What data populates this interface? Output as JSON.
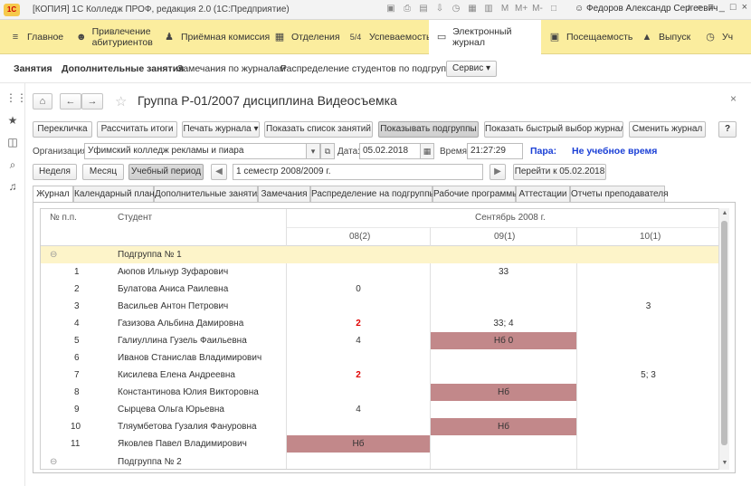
{
  "window": {
    "caption": "[КОПИЯ] 1С Колледж ПРОФ, редакция 2.0  (1С:Предприятие)",
    "user": "Федоров Александр Сергеевич"
  },
  "sections": [
    {
      "label": "Главное",
      "icon": "list-icon"
    },
    {
      "label": "Привлечение абитуриентов",
      "icon": "person-icon"
    },
    {
      "label": "Приёмная комиссия",
      "icon": "walk-icon"
    },
    {
      "label": "Отделения",
      "icon": "building-icon"
    },
    {
      "label": "Успеваемость",
      "icon": "grade-icon",
      "icon_text": "5/4"
    },
    {
      "label": "Электронный журнал",
      "icon": "book-icon"
    },
    {
      "label": "Посещаемость",
      "icon": "calendar-icon"
    },
    {
      "label": "Выпуск",
      "icon": "cap-icon"
    },
    {
      "label": "Уч",
      "icon": "clock-icon"
    }
  ],
  "funcbar": {
    "items": [
      "Занятия",
      "Дополнительные занятия",
      "Замечания по журналам",
      "Распределение студентов по подгруппам"
    ],
    "service": "Сервис"
  },
  "doc": {
    "title": "Группа Р-01/2007 дисциплина Видеосъемка"
  },
  "toolbar": {
    "b1": "Перекличка",
    "b2": "Рассчитать итоги",
    "b3": "Печать журнала",
    "b4": "Показать список занятий",
    "b5": "Показывать подгруппы",
    "b6": "Показать быстрый выбор журнала",
    "b7": "Сменить журнал",
    "help": "?"
  },
  "filters": {
    "org_label": "Организация:",
    "org_value": "Уфимский колледж рекламы и пиара",
    "date_label": "Дата:",
    "date_value": "05.02.2018",
    "time_label": "Время:",
    "time_value": "21:27:29",
    "para_label": "Пара:",
    "para_value": "Не учебное время"
  },
  "period": {
    "week": "Неделя",
    "month": "Месяц",
    "study": "Учебный период",
    "value": "1 семестр 2008/2009 г.",
    "goto": "Перейти к 05.02.2018"
  },
  "tabs": [
    "Журнал",
    "Календарный план",
    "Дополнительные занятия",
    "Замечания",
    "Распределение на подгруппы",
    "Рабочие программы",
    "Аттестации",
    "Отчеты преподавателя"
  ],
  "grid": {
    "col_num": "№ п.п.",
    "col_student": "Студент",
    "month": "Сентябрь 2008 г.",
    "days": [
      "08(2)",
      "09(1)",
      "10(1)"
    ],
    "groups": [
      "Подгруппа № 1",
      "Подгруппа № 2"
    ],
    "rows": [
      {
        "n": "1",
        "name": "Аюпов Ильнур Зуфарович",
        "d1": "",
        "d2": "33",
        "d3": ""
      },
      {
        "n": "2",
        "name": "Булатова Аниса Раилевна",
        "d1": "0",
        "d2": "",
        "d3": ""
      },
      {
        "n": "3",
        "name": "Васильев Антон Петрович",
        "d1": "",
        "d2": "",
        "d3": "3"
      },
      {
        "n": "4",
        "name": "Газизова Альбина Дамировна",
        "d1": "2",
        "d2": "33; 4",
        "d3": ""
      },
      {
        "n": "5",
        "name": "Галиуллина Гузель Фаильевна",
        "d1": "4",
        "d2": "Нб 0",
        "d3": ""
      },
      {
        "n": "6",
        "name": "Иванов Станислав Владимирович",
        "d1": "",
        "d2": "",
        "d3": ""
      },
      {
        "n": "7",
        "name": "Кисилева Елена Андреевна",
        "d1": "2",
        "d2": "",
        "d3": "5; 3"
      },
      {
        "n": "8",
        "name": "Константинова Юлия Викторовна",
        "d1": "",
        "d2": "Нб",
        "d3": ""
      },
      {
        "n": "9",
        "name": "Сырцева Ольга Юрьевна",
        "d1": "4",
        "d2": "",
        "d3": ""
      },
      {
        "n": "10",
        "name": "Тляумбетова Гузалия Фануровна",
        "d1": "",
        "d2": "Нб",
        "d3": ""
      },
      {
        "n": "11",
        "name": "Яковлев Павел Владимирович",
        "d1": "Нб",
        "d2": "",
        "d3": ""
      }
    ]
  },
  "colors": {
    "sections_bg": "#fbed9e",
    "group_row": "#fdf4c9",
    "absent": "#c2888a",
    "low_mark": "#e00000",
    "para_text": "#1a3fd6"
  }
}
